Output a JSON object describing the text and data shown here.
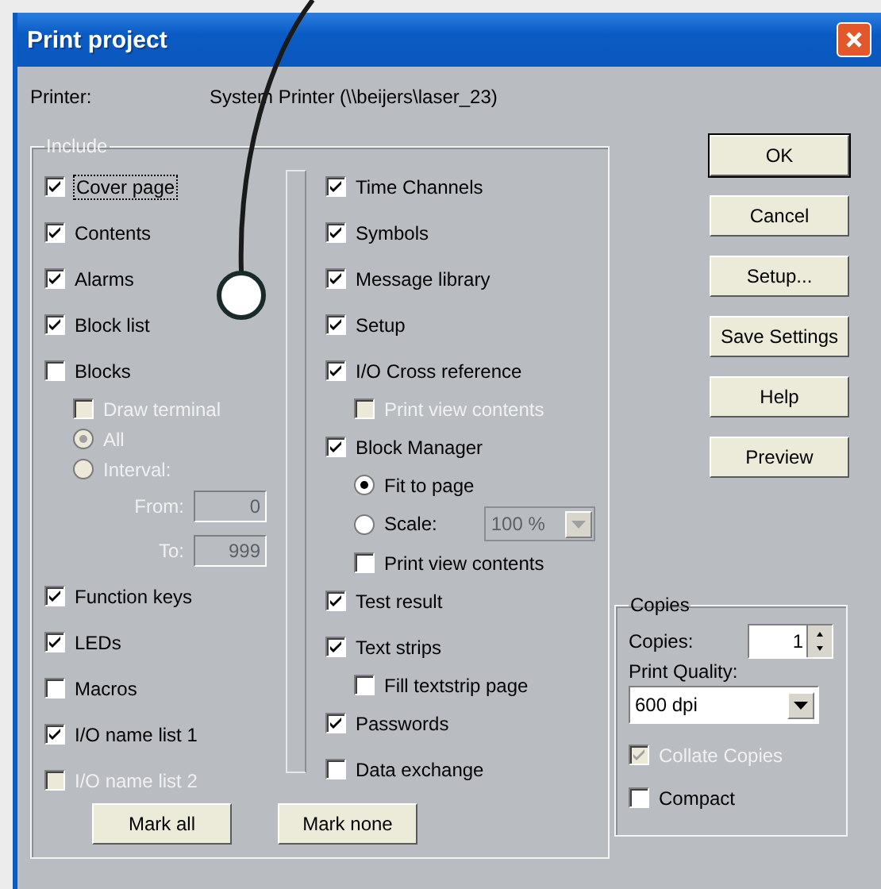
{
  "window": {
    "title": "Print project"
  },
  "printer": {
    "label": "Printer:",
    "value": "System Printer (\\\\beijers\\laser_23)"
  },
  "include": {
    "title": "Include",
    "left": [
      {
        "kind": "checkbox",
        "label": "Cover page",
        "checked": true,
        "focused": true
      },
      {
        "kind": "checkbox",
        "label": "Contents",
        "checked": true
      },
      {
        "kind": "checkbox",
        "label": "Alarms",
        "checked": true
      },
      {
        "kind": "checkbox",
        "label": "Block list",
        "checked": true
      },
      {
        "kind": "checkbox",
        "label": "Blocks",
        "checked": false,
        "children": [
          {
            "kind": "checkbox",
            "label": "Draw terminal",
            "checked": false,
            "disabled": true
          },
          {
            "kind": "radio",
            "label": "All",
            "selected": true,
            "disabled": true
          },
          {
            "kind": "radio",
            "label": "Interval:",
            "selected": false,
            "disabled": true
          },
          {
            "kind": "field",
            "label": "From:",
            "value": "0",
            "disabled": true
          },
          {
            "kind": "field",
            "label": "To:",
            "value": "999",
            "disabled": true
          }
        ]
      },
      {
        "kind": "checkbox",
        "label": "Function keys",
        "checked": true
      },
      {
        "kind": "checkbox",
        "label": "LEDs",
        "checked": true
      },
      {
        "kind": "checkbox",
        "label": "Macros",
        "checked": false
      },
      {
        "kind": "checkbox",
        "label": "I/O name list 1",
        "checked": true
      },
      {
        "kind": "checkbox",
        "label": "I/O name list 2",
        "checked": false,
        "disabled": true
      }
    ],
    "right": [
      {
        "kind": "checkbox",
        "label": "Time Channels",
        "checked": true
      },
      {
        "kind": "checkbox",
        "label": "Symbols",
        "checked": true
      },
      {
        "kind": "checkbox",
        "label": "Message library",
        "checked": true
      },
      {
        "kind": "checkbox",
        "label": "Setup",
        "checked": true
      },
      {
        "kind": "checkbox",
        "label": "I/O Cross reference",
        "checked": true,
        "children": [
          {
            "kind": "checkbox",
            "label": "Print view contents",
            "checked": false,
            "disabled": true
          }
        ]
      },
      {
        "kind": "checkbox",
        "label": "Block Manager",
        "checked": true,
        "children": [
          {
            "kind": "radio",
            "label": "Fit to page",
            "selected": true
          },
          {
            "kind": "radio",
            "label": "Scale:",
            "selected": false,
            "select": {
              "value": "100 %",
              "disabled": true
            }
          },
          {
            "kind": "checkbox",
            "label": "Print view contents",
            "checked": false
          }
        ]
      },
      {
        "kind": "checkbox",
        "label": "Test result",
        "checked": true
      },
      {
        "kind": "checkbox",
        "label": "Text strips",
        "checked": true,
        "children": [
          {
            "kind": "checkbox",
            "label": "Fill textstrip page",
            "checked": false
          }
        ]
      },
      {
        "kind": "checkbox",
        "label": "Passwords",
        "checked": true
      },
      {
        "kind": "checkbox",
        "label": "Data exchange",
        "checked": false
      }
    ],
    "buttons": [
      "Mark all",
      "Mark none"
    ]
  },
  "buttons": [
    {
      "label": "OK",
      "default": true
    },
    {
      "label": "Cancel",
      "default": false
    },
    {
      "label": "Setup...",
      "default": false
    },
    {
      "label": "Save Settings",
      "default": false
    },
    {
      "label": "Help",
      "default": false
    },
    {
      "label": "Preview",
      "default": false
    }
  ],
  "copies": {
    "title": "Copies",
    "copies_label": "Copies:",
    "copies_value": "1",
    "quality_label": "Print Quality:",
    "quality_value": "600 dpi",
    "options": [
      {
        "label": "Collate Copies",
        "checked": true,
        "disabled": true
      },
      {
        "label": "Compact",
        "checked": false,
        "disabled": false
      }
    ]
  }
}
